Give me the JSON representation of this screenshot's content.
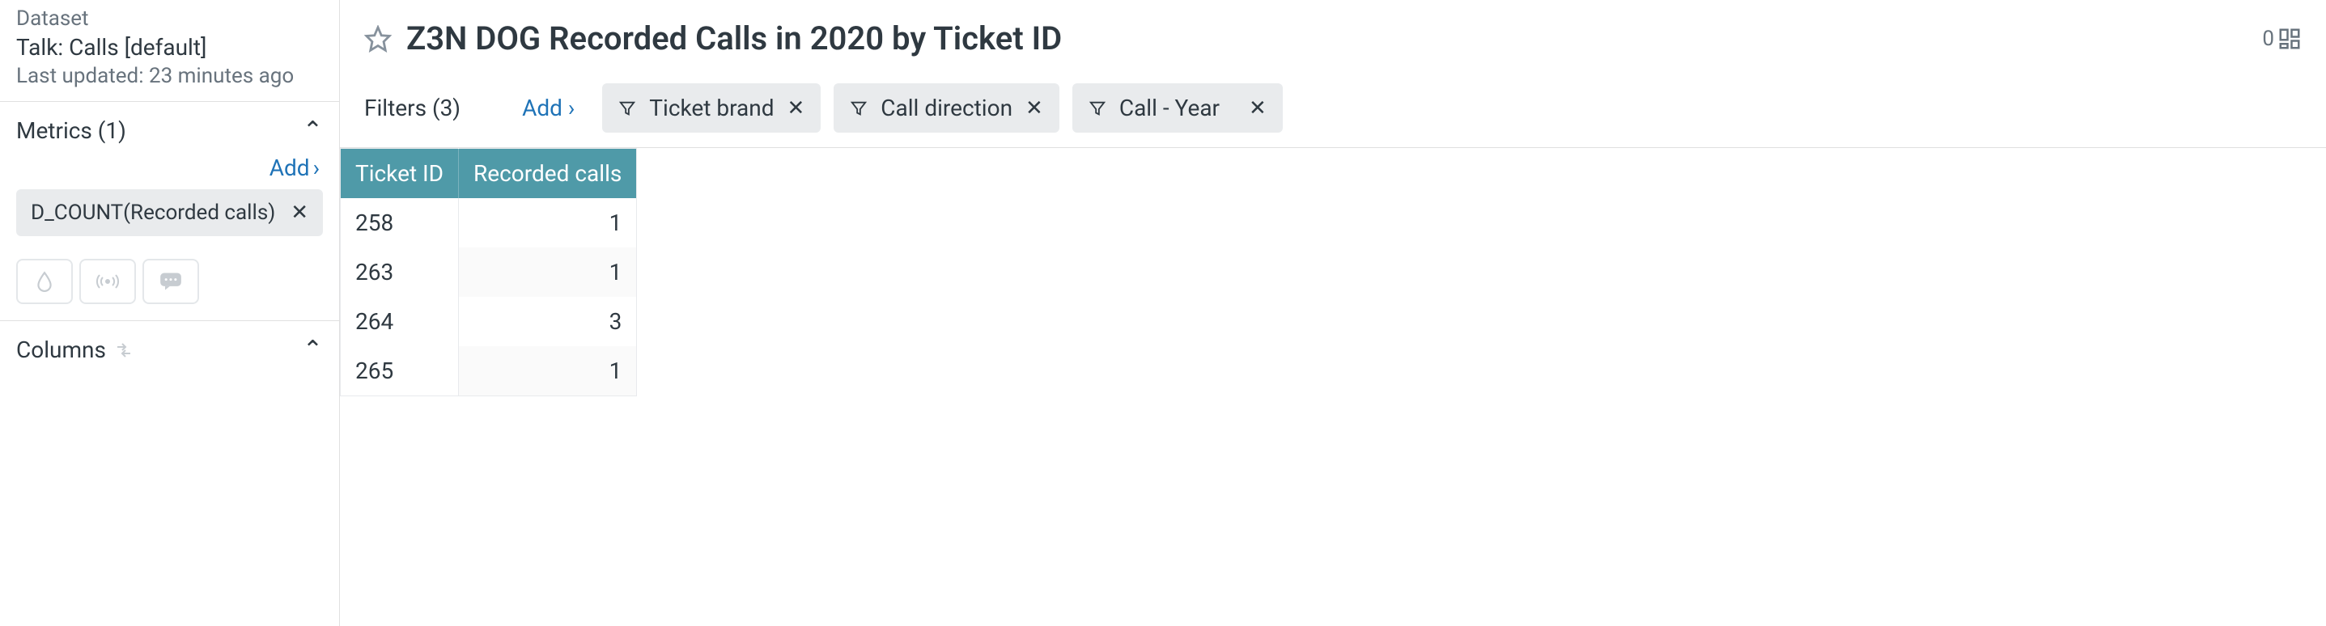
{
  "sidebar": {
    "dataset_label": "Dataset",
    "dataset_name": "Talk: Calls [default]",
    "last_updated": "Last updated: 23 minutes ago",
    "metrics": {
      "title": "Metrics (1)",
      "add_label": "Add",
      "items": [
        {
          "label": "D_COUNT(Recorded calls)"
        }
      ]
    },
    "columns": {
      "title": "Columns"
    }
  },
  "header": {
    "page_title": "Z3N DOG Recorded Calls in 2020 by Ticket ID",
    "layout_count": "0"
  },
  "filters": {
    "label": "Filters (3)",
    "add_label": "Add",
    "items": [
      {
        "label": "Ticket brand"
      },
      {
        "label": "Call direction"
      },
      {
        "label": "Call - Year"
      }
    ]
  },
  "table": {
    "headers": [
      "Ticket ID",
      "Recorded calls"
    ],
    "rows": [
      {
        "id": "258",
        "count": "1"
      },
      {
        "id": "263",
        "count": "1"
      },
      {
        "id": "264",
        "count": "3"
      },
      {
        "id": "265",
        "count": "1"
      }
    ]
  }
}
